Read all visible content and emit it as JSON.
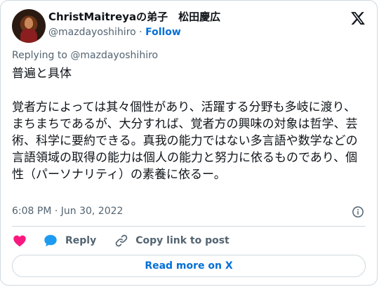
{
  "author": {
    "display_name": "ChristMaitreyaの弟子　松田慶広",
    "handle": "@mazdayoshihiro",
    "separator": "·",
    "follow_label": "Follow"
  },
  "reply_to": "Replying to @mazdayoshihiro",
  "tweet": {
    "text": "普遍と具体\n\n覚者方によっては其々個性があり、活躍する分野も多岐に渡り、まちまちであるが、大分すれば、覚者方の興味の対象は哲学、芸術、科学に要約できる。真我の能力ではない多言語や数学などの言語領域の取得の能力は個人の能力と努力に依るものであり、個性（パーソナリティ）の素養に依るー。",
    "timestamp": "6:08 PM · Jun 30, 2022"
  },
  "actions": {
    "reply_label": "Reply",
    "copy_label": "Copy link to post"
  },
  "read_more_label": "Read more on X",
  "icons": {
    "logo": "x-logo-icon",
    "info": "info-icon",
    "heart": "heart-icon",
    "reply": "reply-bubble-icon",
    "link": "link-icon"
  },
  "colors": {
    "text": "#0f1419",
    "secondary": "#536471",
    "link": "#006fd6",
    "heart": "#f91880",
    "reply_bubble": "#1d9bf0",
    "border": "#cfd9de"
  }
}
